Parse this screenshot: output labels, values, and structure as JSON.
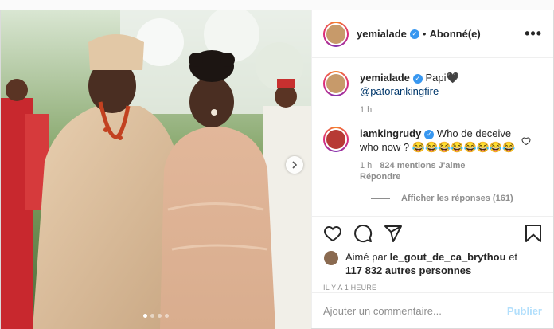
{
  "header": {
    "username": "yemialade",
    "separator": "•",
    "follow_label": "Abonné(e)",
    "more_label": "•••"
  },
  "caption": {
    "username": "yemialade",
    "text": "Papi🖤 ",
    "mention": "@patorankingfire",
    "time": "1 h"
  },
  "comment": {
    "username": "iamkingrudy",
    "text": "Who de deceive who now ? 😂😂😂😂😂😂😂😂",
    "time": "1 h",
    "likes": "824 mentions J'aime",
    "reply_label": "Répondre",
    "view_replies": "Afficher les réponses (161)"
  },
  "likes": {
    "prefix": "Aimé par ",
    "user": "le_gout_de_ca_brythou",
    "and": " et",
    "others": "117 832 autres personnes"
  },
  "timestamp": "IL Y A 1 HEURE",
  "comment_box": {
    "placeholder": "Ajouter un commentaire...",
    "post_label": "Publier"
  },
  "carousel": {
    "slide_count": 4,
    "active_slide": 1
  },
  "icons": {
    "like": "heart-icon",
    "comment": "comment-icon",
    "share": "share-icon",
    "save": "bookmark-icon",
    "next": "chevron-right-icon"
  },
  "colors": {
    "link": "#00376b",
    "verified": "#3897f0",
    "post_disabled": "#b2dffc",
    "muted": "#8e8e8e"
  }
}
